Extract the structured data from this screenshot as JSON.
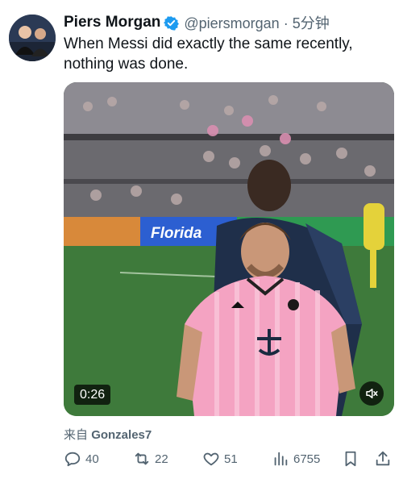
{
  "tweet": {
    "author_name": "Piers Morgan",
    "handle_time": "@piersmorgan · 5分钟",
    "text": "When Messi did exactly the same recently, nothing was done.",
    "source_prefix": "来自",
    "source_name": "Gonzales7"
  },
  "video": {
    "duration": "0:26",
    "mute_icon": "volume-mute-icon",
    "banner_text": "Florida"
  },
  "actions": {
    "reply_count": "40",
    "retweet_count": "22",
    "like_count": "51",
    "view_count": "6755"
  },
  "colors": {
    "verified_blue": "#1d9bf0",
    "muted_text": "#536471",
    "jersey_pink": "#f4a3c2",
    "pitch_green": "#3e7a3b"
  }
}
